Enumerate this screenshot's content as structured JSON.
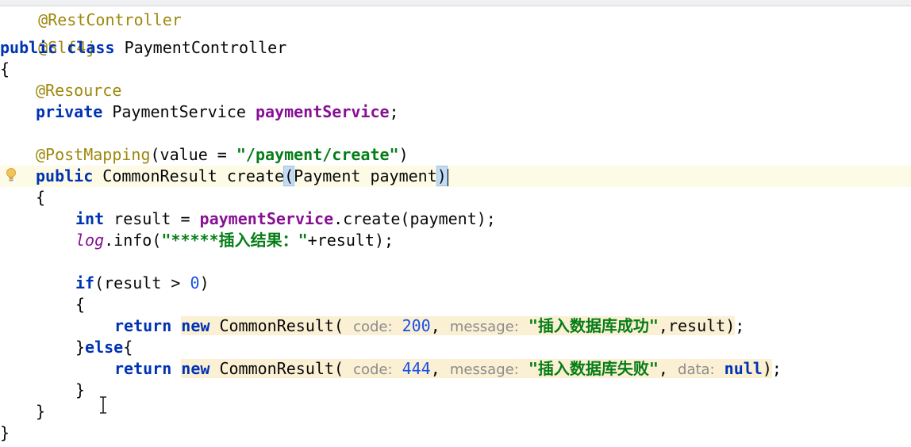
{
  "code": {
    "line_restcontroller": "@RestController",
    "line_slf4j": "@Slf4j",
    "kw_public": "public",
    "kw_class": "class",
    "class_name": "PaymentController",
    "brace_open": "{",
    "brace_close": "}",
    "ann_resource": "@Resource",
    "kw_private": "private",
    "type_payment_service": "PaymentService",
    "field_payment_service": "paymentService",
    "semicolon": ";",
    "ann_postmapping": "@PostMapping",
    "postmapping_open": "(value = ",
    "postmapping_value": "\"/payment/create\"",
    "postmapping_close": ")",
    "method_sig_mid": "CommonResult create",
    "paren_open": "(",
    "param": "Payment payment",
    "paren_close": ")",
    "kw_int": "int",
    "result_assign": "result = ",
    "create_call": ".create(payment);",
    "log_field": "log",
    "log_info_open": ".info(",
    "log_string": "\"*****插入结果：\"",
    "log_info_close": "+result);",
    "kw_if": "if",
    "if_cond_open": "(result > ",
    "zero": "0",
    "if_cond_close": ")",
    "kw_return": "return",
    "kw_new": "new",
    "common_result_open": "CommonResult(",
    "hint_code": "code:",
    "code_200": "200",
    "comma": ",",
    "hint_message": "message:",
    "msg_success": "\"插入数据库成功\"",
    "success_tail": ",result)",
    "else_line": "}else{",
    "code_444": "444",
    "msg_fail": "\"插入数据库失败\"",
    "hint_data": "data:",
    "kw_null": "null",
    "close_paren": ")"
  },
  "colors": {
    "annotation": "#9e880d",
    "keyword": "#0033b3",
    "field": "#871094",
    "string": "#067d17",
    "number": "#1750eb",
    "hint": "#8c8c8c",
    "caret_line": "#fdfbe6",
    "highlight": "#fbf0d4"
  },
  "icons": {
    "gutter": "lightbulb-icon",
    "pointer": "text-cursor-icon"
  }
}
